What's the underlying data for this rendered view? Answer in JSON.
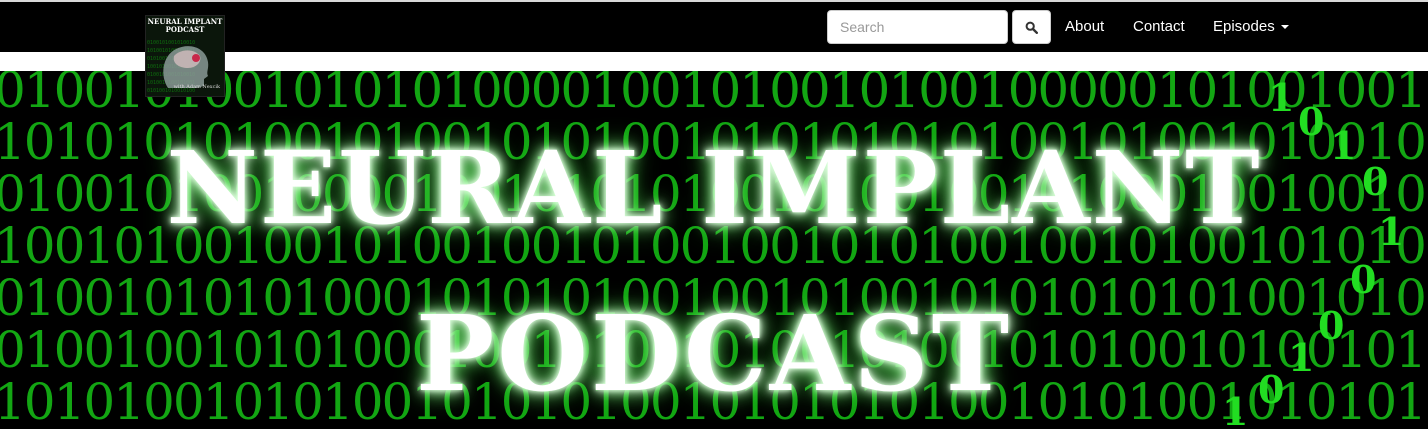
{
  "navbar": {
    "logo": {
      "title": "NEURAL IMPLANT PODCAST",
      "subtitle": "with Adam Nexcik"
    },
    "search": {
      "placeholder": "Search",
      "button_icon": "search-icon"
    },
    "links": [
      {
        "label": "About"
      },
      {
        "label": "Contact"
      },
      {
        "label": "Episodes",
        "icon": "caret-down-icon"
      }
    ]
  },
  "hero": {
    "title_line1": "NEURAL IMPLANT",
    "title_line2": "PODCAST",
    "binary_rows": [
      "01001010010101010000100101001010010000010100100101001010010100010100101000101001010",
      "10101010100101001010100101010101010010100101001001010101001010010010100101010101010",
      "01001010010000100101010100101001001010001001001010100101010101010010100100101010010",
      "10010100100101001001010010010101001001010010101001001001010100101001001010010010100",
      "01001010101000101010100100101001010101010100101001010101001001010101001010101010100",
      "01001001010100010010100101001010010101001010010100101000101001001010101010101001010",
      "10101001010100101010100101010101001010100101010101001010100101010101001010101010101"
    ],
    "accent_color": "#17c417"
  }
}
